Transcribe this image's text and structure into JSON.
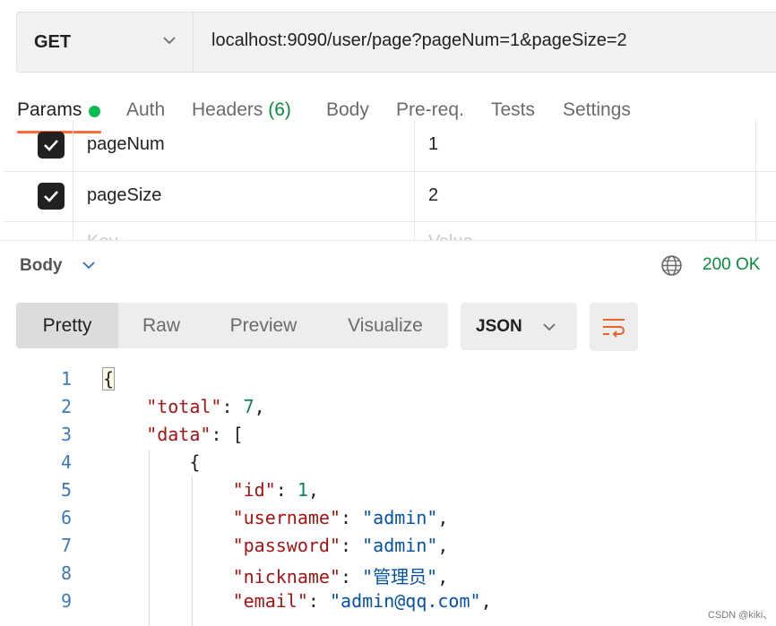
{
  "request": {
    "method": "GET",
    "url": "localhost:9090/user/page?pageNum=1&pageSize=2"
  },
  "request_tabs": {
    "params": "Params",
    "auth": "Auth",
    "headers": "Headers",
    "headers_count": "(6)",
    "body": "Body",
    "prereq": "Pre-req.",
    "tests": "Tests",
    "settings": "Settings"
  },
  "params": {
    "rows": [
      {
        "key": "pageNum",
        "value": "1",
        "checked": true
      },
      {
        "key": "pageSize",
        "value": "2",
        "checked": true
      }
    ],
    "placeholder_key": "Key",
    "placeholder_value": "Value"
  },
  "response": {
    "body_label": "Body",
    "status": "200 OK",
    "views": [
      "Pretty",
      "Raw",
      "Preview",
      "Visualize"
    ],
    "active_view": "Pretty",
    "format": "JSON"
  },
  "code_lines": [
    {
      "n": "1",
      "text": "{"
    },
    {
      "n": "2",
      "key": "\"total\"",
      "sep": ": ",
      "value": "7",
      "vtype": "num",
      "tail": ","
    },
    {
      "n": "3",
      "key": "\"data\"",
      "sep": ": ",
      "value": "[",
      "vtype": "punc",
      "tail": ""
    },
    {
      "n": "4",
      "text": "{"
    },
    {
      "n": "5",
      "key": "\"id\"",
      "sep": ": ",
      "value": "1",
      "vtype": "num",
      "tail": ","
    },
    {
      "n": "6",
      "key": "\"username\"",
      "sep": ": ",
      "value": "\"admin\"",
      "vtype": "str",
      "tail": ","
    },
    {
      "n": "7",
      "key": "\"password\"",
      "sep": ": ",
      "value": "\"admin\"",
      "vtype": "str",
      "tail": ","
    },
    {
      "n": "8",
      "key": "\"nickname\"",
      "sep": ": ",
      "value": "\"管理员\"",
      "vtype": "str",
      "tail": ","
    },
    {
      "n": "9",
      "key": "\"email\"",
      "sep": ": ",
      "value": "\"admin@qq.com\"",
      "vtype": "str",
      "tail": ","
    }
  ],
  "watermark": "CSDN @kiki、",
  "colors": {
    "accent": "#ff6c37",
    "status_green": "#0a8a3e",
    "params_dot": "#0cbb52"
  },
  "icons": [
    "chevron-down-icon",
    "check-icon",
    "globe-icon",
    "wrap-lines-icon"
  ]
}
